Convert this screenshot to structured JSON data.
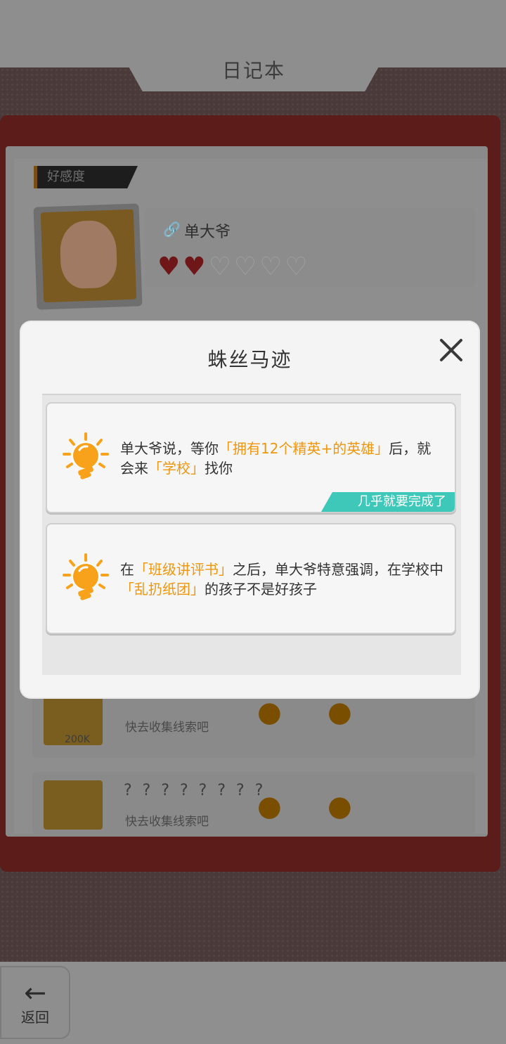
{
  "background": {
    "title": "日记本",
    "favor_label": "好感度",
    "npc": {
      "name": "单大爷",
      "hearts_filled": 2,
      "hearts_total": 6,
      "heart_full_glyph": "♥",
      "heart_empty_glyph": "♡"
    },
    "rows": [
      {
        "question": "? ? ? ? ? ? ? ?",
        "hint": "快去收集线索吧",
        "value": "200K"
      },
      {
        "question": "? ? ? ? ? ? ? ?",
        "hint": "快去收集线索吧",
        "value": ""
      }
    ],
    "back_button": {
      "arrow": "←",
      "label": "返回"
    }
  },
  "modal": {
    "title": "蛛丝马迹",
    "close_icon": "close-icon",
    "clues": [
      {
        "icon": "lightbulb-icon",
        "segments": [
          {
            "text": "单大爷说，等你",
            "highlight": false
          },
          {
            "text": "「拥有12个精英+的英雄」",
            "highlight": true
          },
          {
            "text": "后，就会来",
            "highlight": false
          },
          {
            "text": "「学校」",
            "highlight": true
          },
          {
            "text": "找你",
            "highlight": false
          }
        ],
        "badge": "几乎就要完成了"
      },
      {
        "icon": "lightbulb-icon",
        "segments": [
          {
            "text": "在",
            "highlight": false
          },
          {
            "text": "「班级讲评书」",
            "highlight": true
          },
          {
            "text": "之后，单大爷特意强调，在学校中",
            "highlight": false
          },
          {
            "text": "「乱扔纸团」",
            "highlight": true
          },
          {
            "text": "的孩子不是好孩子",
            "highlight": false
          }
        ],
        "badge": ""
      }
    ]
  },
  "colors": {
    "highlight": "#f0960e",
    "badge": "#3ec8ba",
    "bulb": "#f8a21c"
  }
}
